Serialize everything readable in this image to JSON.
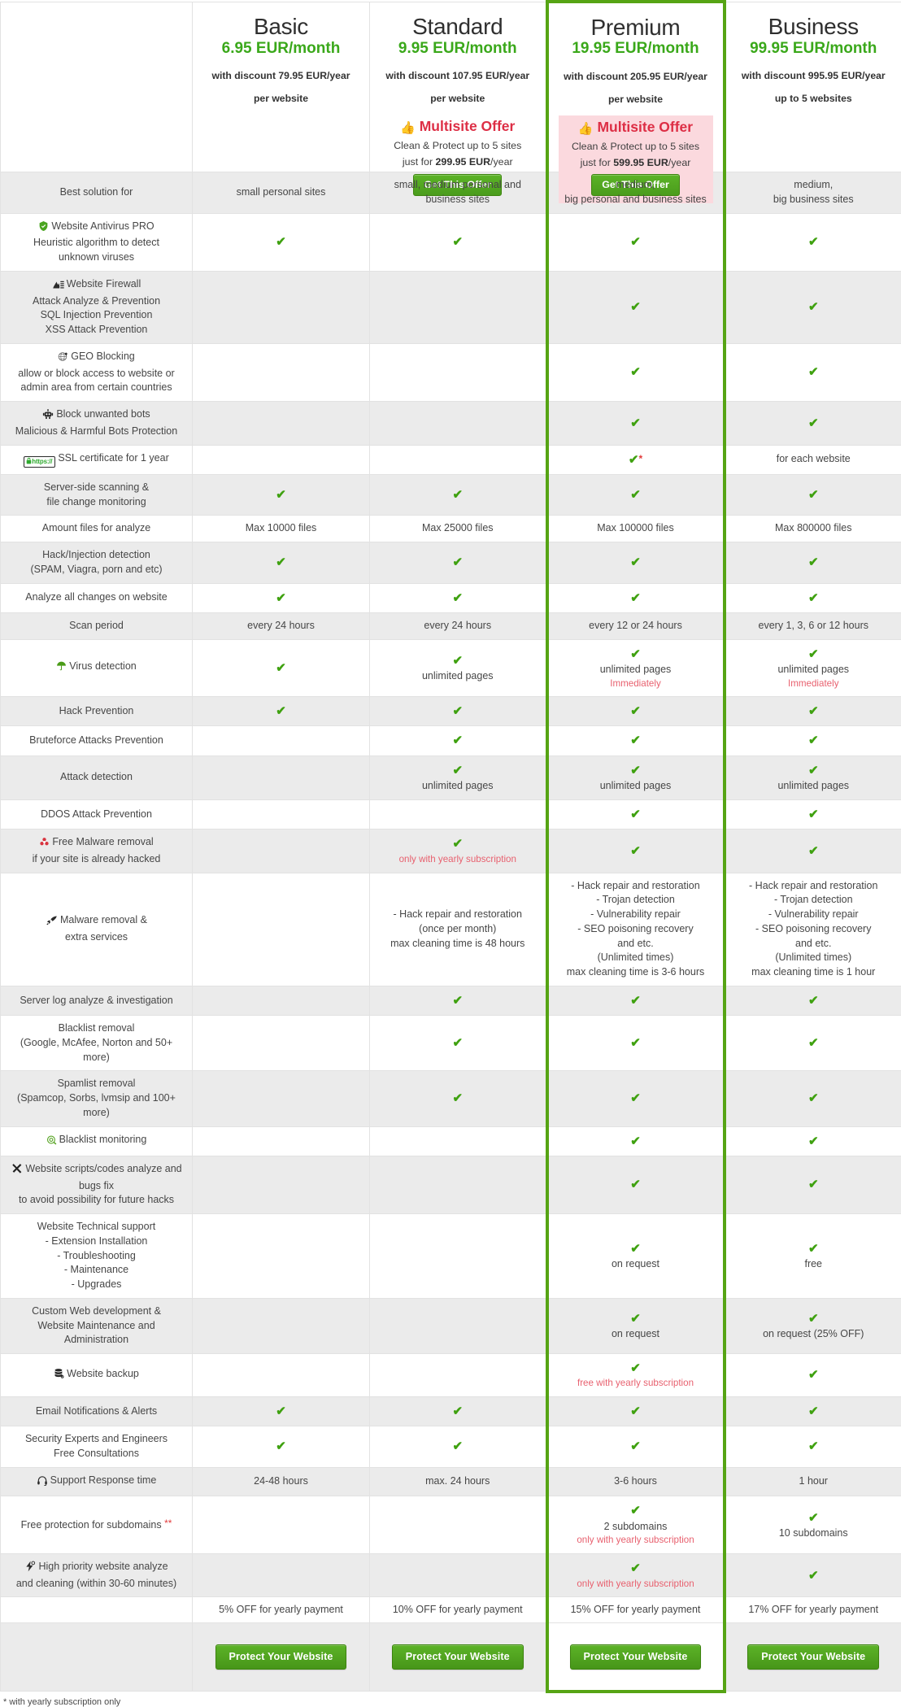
{
  "plans": [
    {
      "name": "Basic",
      "price": "6.95 EUR/month",
      "discount": "with discount 79.95 EUR/year",
      "sub": "per website",
      "multisite": null,
      "yearly_off": "5% OFF for yearly payment",
      "cta": "Protect Your Website"
    },
    {
      "name": "Standard",
      "price": "9.95 EUR/month",
      "discount": "with discount 107.95 EUR/year",
      "sub": "per website",
      "multisite": {
        "title": "Multisite Offer",
        "line1": "Clean & Protect up to 5 sites",
        "line2_prefix": "just for ",
        "line2_amount": "299.95 EUR",
        "line2_suffix": "/year",
        "button": "Get This Offer"
      },
      "yearly_off": "10% OFF for yearly payment",
      "cta": "Protect Your Website"
    },
    {
      "name": "Premium",
      "price": "19.95 EUR/month",
      "discount": "with discount 205.95 EUR/year",
      "sub": "per website",
      "multisite": {
        "title": "Multisite Offer",
        "line1": "Clean & Protect up to 5 sites",
        "line2_prefix": "just for ",
        "line2_amount": "599.95 EUR",
        "line2_suffix": "/year",
        "button": "Get This Offer"
      },
      "yearly_off": "15% OFF for yearly payment",
      "cta": "Protect Your Website"
    },
    {
      "name": "Business",
      "price": "99.95 EUR/month",
      "discount": "with discount 995.95 EUR/year",
      "sub": "up to 5 websites",
      "multisite": null,
      "yearly_off": "17% OFF for yearly payment",
      "cta": "Protect Your Website"
    }
  ],
  "highlight_color": "#56a414",
  "accent_green": "#3aa81a",
  "accent_red": "#dd2e45",
  "rows": [
    {
      "icon": null,
      "feature": [
        "Best solution for"
      ],
      "cells": [
        {
          "lines": [
            "small personal sites"
          ]
        },
        {
          "lines": [
            "small, medium personal and",
            "business sites"
          ]
        },
        {
          "lines": [
            "medium,",
            "big personal and business sites"
          ]
        },
        {
          "lines": [
            "medium,",
            "big business sites"
          ]
        }
      ]
    },
    {
      "icon": "shield-check-icon",
      "feature": [
        "Website Antivirus PRO",
        "Heuristic algorithm to detect",
        "unknown viruses"
      ],
      "cells": [
        {
          "check": true
        },
        {
          "check": true
        },
        {
          "check": true
        },
        {
          "check": true
        }
      ]
    },
    {
      "icon": "firewall-icon",
      "feature": [
        "Website Firewall",
        "Attack Analyze & Prevention",
        "SQL Injection Prevention",
        "XSS Attack Prevention"
      ],
      "cells": [
        {},
        {},
        {
          "check": true
        },
        {
          "check": true
        }
      ]
    },
    {
      "icon": "globe-pin-icon",
      "feature": [
        "GEO Blocking",
        "allow or block access to website or",
        "admin area from certain countries"
      ],
      "cells": [
        {},
        {},
        {
          "check": true
        },
        {
          "check": true
        }
      ]
    },
    {
      "icon": "robot-icon",
      "feature": [
        "Block unwanted bots",
        "Malicious & Harmful Bots Protection"
      ],
      "cells": [
        {},
        {},
        {
          "check": true
        },
        {
          "check": true
        }
      ]
    },
    {
      "icon": "https-lock-icon",
      "feature": [
        "SSL certificate for 1 year"
      ],
      "cells": [
        {},
        {},
        {
          "check": true,
          "asterisk": "*"
        },
        {
          "check": false,
          "lines": [
            "for each website"
          ]
        }
      ]
    },
    {
      "icon": null,
      "feature": [
        "Server-side scanning &",
        "file change monitoring"
      ],
      "cells": [
        {
          "check": true
        },
        {
          "check": true
        },
        {
          "check": true
        },
        {
          "check": true
        }
      ]
    },
    {
      "icon": null,
      "feature": [
        "Amount files for analyze"
      ],
      "cells": [
        {
          "lines": [
            "Max 10000 files"
          ]
        },
        {
          "lines": [
            "Max 25000 files"
          ]
        },
        {
          "lines": [
            "Max 100000 files"
          ]
        },
        {
          "lines": [
            "Max 800000 files"
          ]
        }
      ]
    },
    {
      "icon": null,
      "feature": [
        "Hack/Injection detection",
        "(SPAM, Viagra, porn and etc)"
      ],
      "cells": [
        {
          "check": true
        },
        {
          "check": true
        },
        {
          "check": true
        },
        {
          "check": true
        }
      ]
    },
    {
      "icon": null,
      "feature": [
        "Analyze all changes on website"
      ],
      "cells": [
        {
          "check": true
        },
        {
          "check": true
        },
        {
          "check": true
        },
        {
          "check": true
        }
      ]
    },
    {
      "icon": null,
      "feature": [
        "Scan period"
      ],
      "cells": [
        {
          "lines": [
            "every 24 hours"
          ]
        },
        {
          "lines": [
            "every 24 hours"
          ]
        },
        {
          "lines": [
            "every 12 or 24 hours"
          ]
        },
        {
          "lines": [
            "every 1, 3, 6 or 12 hours"
          ]
        }
      ]
    },
    {
      "icon": "umbrella-icon",
      "feature": [
        "Virus detection"
      ],
      "cells": [
        {
          "check": true
        },
        {
          "check": true,
          "lines": [
            "unlimited pages"
          ]
        },
        {
          "check": true,
          "lines": [
            "unlimited pages"
          ],
          "red": "Immediately"
        },
        {
          "check": true,
          "lines": [
            "unlimited pages"
          ],
          "red": "Immediately"
        }
      ]
    },
    {
      "icon": null,
      "feature": [
        "Hack Prevention"
      ],
      "cells": [
        {
          "check": true
        },
        {
          "check": true
        },
        {
          "check": true
        },
        {
          "check": true
        }
      ]
    },
    {
      "icon": null,
      "feature": [
        "Bruteforce Attacks Prevention"
      ],
      "cells": [
        {},
        {
          "check": true
        },
        {
          "check": true
        },
        {
          "check": true
        }
      ]
    },
    {
      "icon": null,
      "feature": [
        "Attack detection"
      ],
      "cells": [
        {},
        {
          "check": true,
          "lines": [
            "unlimited pages"
          ]
        },
        {
          "check": true,
          "lines": [
            "unlimited pages"
          ]
        },
        {
          "check": true,
          "lines": [
            "unlimited pages"
          ]
        }
      ]
    },
    {
      "icon": null,
      "feature": [
        "DDOS Attack Prevention"
      ],
      "cells": [
        {},
        {},
        {
          "check": true
        },
        {
          "check": true
        }
      ]
    },
    {
      "icon": "biohazard-icon",
      "feature": [
        "Free Malware removal",
        "if your site is already hacked"
      ],
      "cells": [
        {},
        {
          "check": true,
          "red": "only with yearly subscription"
        },
        {
          "check": true
        },
        {
          "check": true
        }
      ]
    },
    {
      "icon": "rocket-icon",
      "feature": [
        "Malware removal &",
        "extra services"
      ],
      "cells": [
        {},
        {
          "lines": [
            "- Hack repair and restoration",
            "(once per month)",
            "max cleaning time is 48 hours"
          ]
        },
        {
          "lines": [
            "- Hack repair and restoration",
            "- Trojan detection",
            "- Vulnerability repair",
            "- SEO poisoning recovery",
            "and etc.",
            "(Unlimited times)",
            "max cleaning time is 3-6 hours"
          ]
        },
        {
          "lines": [
            "- Hack repair and restoration",
            "- Trojan detection",
            "- Vulnerability repair",
            "- SEO poisoning recovery",
            "and etc.",
            "(Unlimited times)",
            "max cleaning time is 1 hour"
          ]
        }
      ]
    },
    {
      "icon": null,
      "feature": [
        "Server log analyze & investigation"
      ],
      "cells": [
        {},
        {
          "check": true
        },
        {
          "check": true
        },
        {
          "check": true
        }
      ]
    },
    {
      "icon": null,
      "feature": [
        "Blacklist removal",
        "(Google, McAfee, Norton and 50+ more)"
      ],
      "cells": [
        {},
        {
          "check": true
        },
        {
          "check": true
        },
        {
          "check": true
        }
      ]
    },
    {
      "icon": null,
      "feature": [
        "Spamlist removal",
        "(Spamcop, Sorbs, lvmsip and 100+ more)"
      ],
      "cells": [
        {},
        {
          "check": true
        },
        {
          "check": true
        },
        {
          "check": true
        }
      ]
    },
    {
      "icon": "radar-icon",
      "feature": [
        "Blacklist monitoring"
      ],
      "cells": [
        {},
        {},
        {
          "check": true
        },
        {
          "check": true
        }
      ]
    },
    {
      "icon": "tools-icon",
      "feature": [
        "Website scripts/codes analyze and bugs fix",
        "to avoid possibility for future hacks"
      ],
      "cells": [
        {},
        {},
        {
          "check": true
        },
        {
          "check": true
        }
      ]
    },
    {
      "icon": null,
      "feature": [
        "Website Technical support",
        "- Extension Installation",
        "- Troubleshooting",
        "- Maintenance",
        "- Upgrades"
      ],
      "cells": [
        {},
        {},
        {
          "check": true,
          "lines": [
            "on request"
          ]
        },
        {
          "check": true,
          "lines": [
            "free"
          ]
        }
      ]
    },
    {
      "icon": null,
      "feature": [
        "Custom Web development &",
        "Website Maintenance and Administration"
      ],
      "cells": [
        {},
        {},
        {
          "check": true,
          "lines": [
            "on request"
          ]
        },
        {
          "check": true,
          "lines": [
            "on request (25% OFF)"
          ]
        }
      ]
    },
    {
      "icon": "database-icon",
      "feature": [
        "Website backup"
      ],
      "cells": [
        {},
        {},
        {
          "check": true,
          "red": "free with yearly subscription"
        },
        {
          "check": true
        }
      ]
    },
    {
      "icon": null,
      "feature": [
        "Email Notifications & Alerts"
      ],
      "cells": [
        {
          "check": true
        },
        {
          "check": true
        },
        {
          "check": true
        },
        {
          "check": true
        }
      ]
    },
    {
      "icon": null,
      "feature": [
        "Security Experts and Engineers",
        "Free Consultations"
      ],
      "cells": [
        {
          "check": true
        },
        {
          "check": true
        },
        {
          "check": true
        },
        {
          "check": true
        }
      ]
    },
    {
      "icon": "headset-icon",
      "feature": [
        "Support Response time"
      ],
      "cells": [
        {
          "lines": [
            "24-48 hours"
          ]
        },
        {
          "lines": [
            "max. 24 hours"
          ]
        },
        {
          "lines": [
            "3-6 hours"
          ]
        },
        {
          "lines": [
            "1 hour"
          ]
        }
      ]
    },
    {
      "icon": null,
      "feature": [
        "Free protection for subdomains "
      ],
      "feature_sup": "**",
      "cells": [
        {},
        {},
        {
          "check": true,
          "lines": [
            "2 subdomains"
          ],
          "red": "only with yearly subscription"
        },
        {
          "check": true,
          "lines": [
            "10 subdomains"
          ]
        }
      ]
    },
    {
      "icon": "bolt-clean-icon",
      "feature": [
        "High priority website analyze",
        "and cleaning (within 30-60 minutes)"
      ],
      "cells": [
        {},
        {},
        {
          "check": true,
          "red": "only with yearly subscription"
        },
        {
          "check": true
        }
      ]
    }
  ],
  "footnote": "*  with yearly subscription only"
}
